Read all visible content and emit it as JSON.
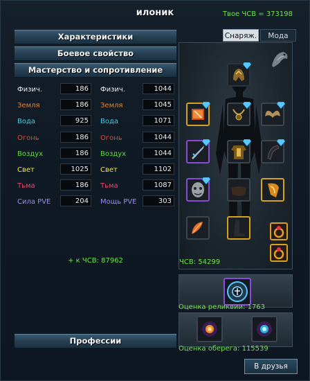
{
  "window": {
    "title": "илоник",
    "csv_total": "Твое ЧСВ = 373198"
  },
  "sections": {
    "characteristics": "Характеристики",
    "combat": "Боевое свойство",
    "mastery": "Мастерство и сопротивление",
    "professions": "Профессии"
  },
  "stats": [
    {
      "label_a": "Физич.",
      "val_a": "186",
      "label_b": "Физич.",
      "val_b": "1044",
      "color": "#e8eaec"
    },
    {
      "label_a": "Земля",
      "val_a": "186",
      "label_b": "Земля",
      "val_b": "1045",
      "color": "#d8883a"
    },
    {
      "label_a": "Вода",
      "val_a": "925",
      "label_b": "Вода",
      "val_b": "1071",
      "color": "#3fd0e6"
    },
    {
      "label_a": "Огонь",
      "val_a": "186",
      "label_b": "Огонь",
      "val_b": "1044",
      "color": "#e8462e"
    },
    {
      "label_a": "Воздух",
      "val_a": "186",
      "label_b": "Воздух",
      "val_b": "1044",
      "color": "#66d84a"
    },
    {
      "label_a": "Свет",
      "val_a": "1025",
      "label_b": "Свет",
      "val_b": "1102",
      "color": "#f2e24a"
    },
    {
      "label_a": "Тьма",
      "val_a": "186",
      "label_b": "Тьма",
      "val_b": "1087",
      "color": "#e0486e"
    },
    {
      "label_a": "Сила PVE",
      "val_a": "204",
      "label_b": "Мощь PVE",
      "val_b": "303",
      "color": "#9a8cf0"
    }
  ],
  "csv_bonus": "+ к ЧСВ: 87962",
  "tabs": {
    "equipment": "Снаряж.",
    "fashion": "Мода"
  },
  "equipment": {
    "csv": "ЧСВ: 54299"
  },
  "relic": {
    "rating": "Оценка реликвии: 1763"
  },
  "amulet": {
    "rating": "Оценка оберега: 115539"
  },
  "buttons": {
    "to_friends": "В друзья"
  },
  "colors": {
    "accent_green": "#6ee34e",
    "slot_gold": "#d7a21c",
    "slot_purple": "#8a4bd8"
  }
}
